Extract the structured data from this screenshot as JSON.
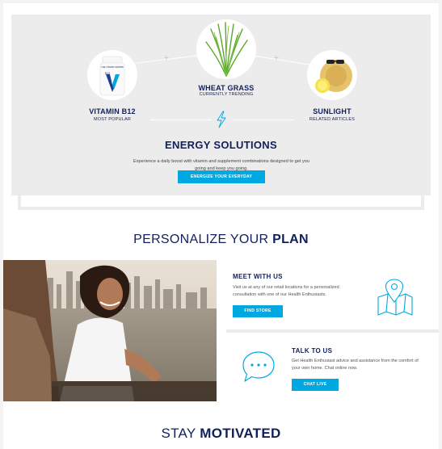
{
  "products": {
    "vitamin": {
      "title": "VITAMIN B12",
      "subtitle": "MOST POPULAR",
      "bottle_brand": "THE VITAMIN SHOPPE",
      "bottle_label": "B12"
    },
    "wheatgrass": {
      "title": "WHEAT GRASS",
      "subtitle": "CURRENTLY TRENDING"
    },
    "sunlight": {
      "title": "SUNLIGHT",
      "subtitle": "RELATED ARTICLES"
    }
  },
  "energy": {
    "title": "ENERGY SOLUTIONS",
    "text": "Experience a daily boost with vitamin and supplement combinations designed to get you going and keep you going.",
    "button": "ENERGIZE YOUR EVERYDAY"
  },
  "personalize": {
    "heading_light": "PERSONALIZE YOUR ",
    "heading_bold": "PLAN"
  },
  "meet": {
    "title": "MEET WITH US",
    "text": "Visit us at any of our retail locations for a personalized consultation with one of our Health Enthusiasts.",
    "button": "FIND STORE",
    "icon": "map-pin-icon"
  },
  "talk": {
    "title": "TALK TO US",
    "text": "Get Health Enthusiast advice and assistance from the comfort of your own home. Chat online now.",
    "button": "CHAT LIVE",
    "icon": "chat-bubble-icon"
  },
  "motivated": {
    "heading_light": "STAY ",
    "heading_bold": "MOTIVATED"
  },
  "colors": {
    "navy": "#11205c",
    "accent": "#00a8e1",
    "panel": "#ececec"
  }
}
